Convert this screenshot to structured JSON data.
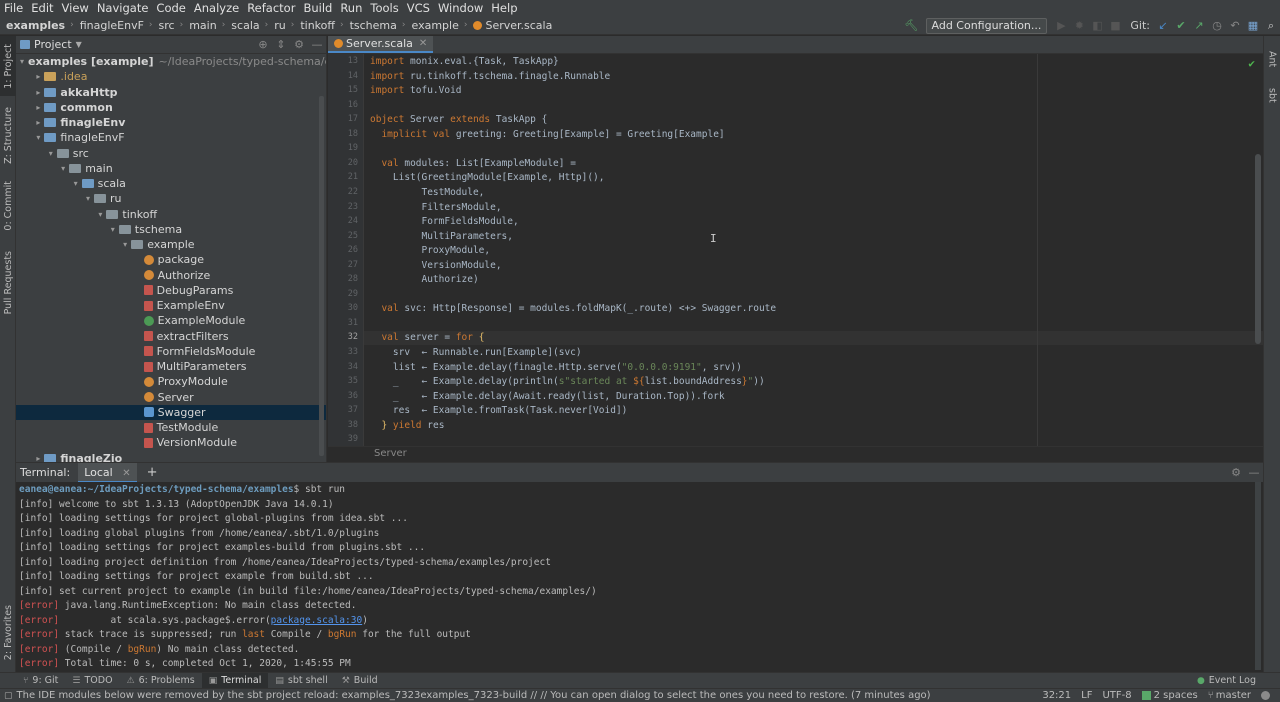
{
  "menu": [
    "File",
    "Edit",
    "View",
    "Navigate",
    "Code",
    "Analyze",
    "Refactor",
    "Build",
    "Run",
    "Tools",
    "VCS",
    "Window",
    "Help"
  ],
  "nav": {
    "crumbs": [
      "examples",
      "finagleEnvF",
      "src",
      "main",
      "scala",
      "ru",
      "tinkoff",
      "tschema",
      "example"
    ],
    "file": "Server.scala",
    "add_config": "Add Configuration...",
    "git_label": "Git:"
  },
  "left_stripe": [
    "1: Project",
    "Z: Structure",
    "0: Commit",
    "Pull Requests",
    "2: Favorites"
  ],
  "right_stripe": [
    "Ant",
    "sbt"
  ],
  "project": {
    "title": "Project",
    "tree": [
      {
        "label": "examples [example]",
        "extra": "~/IdeaProjects/typed-schema/example",
        "bold": true,
        "depth": 0,
        "arrow": "▾",
        "icon": "folder"
      },
      {
        "label": ".idea",
        "depth": 1,
        "arrow": "▸",
        "icon": "folder",
        "orange": true
      },
      {
        "label": "akkaHttp",
        "depth": 1,
        "arrow": "▸",
        "icon": "folder-blue",
        "bold": true
      },
      {
        "label": "common",
        "depth": 1,
        "arrow": "▸",
        "icon": "folder-blue",
        "bold": true
      },
      {
        "label": "finagleEnv",
        "depth": 1,
        "arrow": "▸",
        "icon": "folder-blue",
        "bold": true
      },
      {
        "label": "finagleEnvF",
        "depth": 1,
        "arrow": "▾",
        "icon": "folder-blue"
      },
      {
        "label": "src",
        "depth": 2,
        "arrow": "▾",
        "icon": "folder"
      },
      {
        "label": "main",
        "depth": 3,
        "arrow": "▾",
        "icon": "folder"
      },
      {
        "label": "scala",
        "depth": 4,
        "arrow": "▾",
        "icon": "folder-blue"
      },
      {
        "label": "ru",
        "depth": 5,
        "arrow": "▾",
        "icon": "folder"
      },
      {
        "label": "tinkoff",
        "depth": 6,
        "arrow": "▾",
        "icon": "folder"
      },
      {
        "label": "tschema",
        "depth": 7,
        "arrow": "▾",
        "icon": "folder"
      },
      {
        "label": "example",
        "depth": 8,
        "arrow": "▾",
        "icon": "folder"
      },
      {
        "label": "package",
        "depth": 9,
        "icon": "obj"
      },
      {
        "label": "Authorize",
        "depth": 9,
        "icon": "obj"
      },
      {
        "label": "DebugParams",
        "depth": 9,
        "icon": "file"
      },
      {
        "label": "ExampleEnv",
        "depth": 9,
        "icon": "file"
      },
      {
        "label": "ExampleModule",
        "depth": 9,
        "icon": "trt"
      },
      {
        "label": "extractFilters",
        "depth": 9,
        "icon": "file"
      },
      {
        "label": "FormFieldsModule",
        "depth": 9,
        "icon": "file"
      },
      {
        "label": "MultiParameters",
        "depth": 9,
        "icon": "file"
      },
      {
        "label": "ProxyModule",
        "depth": 9,
        "icon": "obj"
      },
      {
        "label": "Server",
        "depth": 9,
        "icon": "obj"
      },
      {
        "label": "Swagger",
        "depth": 9,
        "icon": "cls",
        "selected": true
      },
      {
        "label": "TestModule",
        "depth": 9,
        "icon": "file"
      },
      {
        "label": "VersionModule",
        "depth": 9,
        "icon": "file"
      },
      {
        "label": "finagleZio",
        "depth": 1,
        "arrow": "▸",
        "icon": "folder-blue",
        "bold": true
      }
    ]
  },
  "editor": {
    "tab": "Server.scala",
    "footer_crumb": "Server",
    "current_line": 32,
    "lines": [
      {
        "n": 13,
        "html": "<span class=\"kw\">import</span> monix.eval.{Task, TaskApp}"
      },
      {
        "n": 14,
        "html": "<span class=\"kw\">import</span> ru.tinkoff.tschema.finagle.Runnable"
      },
      {
        "n": 15,
        "html": "<span class=\"kw\">import</span> tofu.Void"
      },
      {
        "n": 16,
        "html": ""
      },
      {
        "n": 17,
        "html": "<span class=\"kw\">object</span> Server <span class=\"kw\">extends</span> TaskApp {"
      },
      {
        "n": 18,
        "html": "  <span class=\"kw\">implicit val</span> greeting: Greeting[Example] = Greeting[Example]"
      },
      {
        "n": 19,
        "html": ""
      },
      {
        "n": 20,
        "html": "  <span class=\"kw\">val</span> modules: List[ExampleModule] ="
      },
      {
        "n": 21,
        "html": "    List(GreetingModule[Example, Http](),"
      },
      {
        "n": 22,
        "html": "         TestModule,"
      },
      {
        "n": 23,
        "html": "         FiltersModule,"
      },
      {
        "n": 24,
        "html": "         FormFieldsModule,"
      },
      {
        "n": 25,
        "html": "         MultiParameters,"
      },
      {
        "n": 26,
        "html": "         ProxyModule,"
      },
      {
        "n": 27,
        "html": "         VersionModule,"
      },
      {
        "n": 28,
        "html": "         Authorize)"
      },
      {
        "n": 29,
        "html": ""
      },
      {
        "n": 30,
        "html": "  <span class=\"kw\">val</span> svc: Http[Response] = modules.foldMapK(_.route) &lt;+&gt; Swagger.route"
      },
      {
        "n": 31,
        "html": ""
      },
      {
        "n": 32,
        "html": "  <span class=\"kw\">val</span> server = <span class=\"kw\">for</span> <span style=\"color:#e8bf6a\">{</span>"
      },
      {
        "n": 33,
        "html": "    srv  ← Runnable.run[Example](svc)"
      },
      {
        "n": 34,
        "html": "    list ← Example.delay(finagle.Http.serve(<span class=\"st\">\"0.0.0.0:9191\"</span>, srv))"
      },
      {
        "n": 35,
        "html": "    _    ← Example.delay(println(<span class=\"st\">s\"started at </span><span class=\"kw\">${</span>list.boundAddress<span class=\"kw\">}</span><span class=\"st\">\"</span>))"
      },
      {
        "n": 36,
        "html": "    _    ← Example.delay(Await.ready(list, Duration.Top)).fork"
      },
      {
        "n": 37,
        "html": "    res  ← Example.fromTask(Task.never[Void])"
      },
      {
        "n": 38,
        "html": "  <span style=\"color:#e8bf6a\">}</span> <span class=\"kw\">yield</span> res"
      },
      {
        "n": 39,
        "html": ""
      }
    ]
  },
  "terminal": {
    "label": "Terminal:",
    "tab": "Local",
    "prompt_user": "eanea@eanea",
    "prompt_path": ":~/IdeaProjects/typed-schema/examples",
    "command": "$ sbt run",
    "lines": [
      "[info] welcome to sbt 1.3.13 (AdoptOpenJDK Java 14.0.1)",
      "[info] loading settings for project global-plugins from idea.sbt ...",
      "[info] loading global plugins from /home/eanea/.sbt/1.0/plugins",
      "[info] loading settings for project examples-build from plugins.sbt ...",
      "[info] loading project definition from /home/eanea/IdeaProjects/typed-schema/examples/project",
      "[info] loading settings for project example from build.sbt ...",
      "[info] set current project to example (in build file:/home/eanea/IdeaProjects/typed-schema/examples/)"
    ],
    "errors": [
      {
        "tag": "[error]",
        "text": " java.lang.RuntimeException: No main class detected."
      },
      {
        "tag": "[error]",
        "text": "         at scala.sys.package$.error(",
        "link": "package.scala:30",
        "after": ")"
      },
      {
        "tag": "[error]",
        "text": " stack trace is suppressed; run ",
        "kw1": "last",
        "mid1": " Compile / ",
        "kw2": "bgRun",
        "after": " for the full output"
      },
      {
        "tag": "[error]",
        "text": " (Compile / ",
        "kw1": "bgRun",
        "after": ") No main class detected."
      },
      {
        "tag": "[error]",
        "text": " Total time: 0 s, completed Oct 1, 2020, 1:45:55 PM"
      }
    ]
  },
  "bottom_tools": [
    {
      "label": "9: Git",
      "icon": "⑂"
    },
    {
      "label": "TODO",
      "icon": "☰"
    },
    {
      "label": "6: Problems",
      "icon": "⚠"
    },
    {
      "label": "Terminal",
      "icon": "▣",
      "active": true
    },
    {
      "label": "sbt shell",
      "icon": "▤"
    },
    {
      "label": "Build",
      "icon": "⚒"
    }
  ],
  "event_log": "Event Log",
  "status": {
    "message": "The IDE modules below were removed by the sbt project reload: examples_7323examples_7323-build // // You can open dialog to select the ones you need to restore. (7 minutes ago)",
    "position": "32:21",
    "line_sep": "LF",
    "encoding": "UTF-8",
    "indent": "2 spaces",
    "branch": "master"
  }
}
